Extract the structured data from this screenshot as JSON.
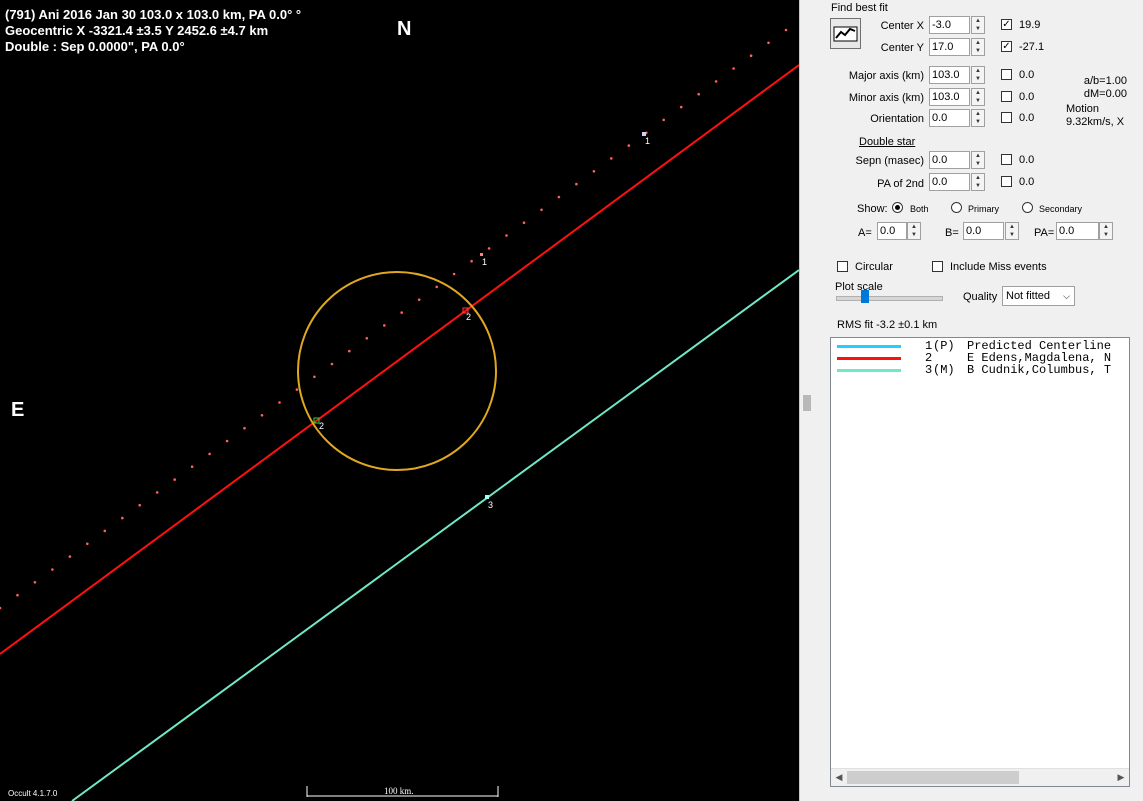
{
  "header": {
    "line1": "(791) Ani  2016 Jan 30   103.0 x 103.0 km, PA 0.0° °",
    "line2": "Geocentric  X  -3321.4 ±3.5  Y 2452.6 ±4.7 km",
    "line3": "Double : Sep  0.0000\", PA 0.0°"
  },
  "compass": {
    "north": "N",
    "east": "E"
  },
  "chord_labels": [
    "1",
    "1",
    "2",
    "2",
    "3"
  ],
  "scale_bar_label": "100 km.",
  "version": "Occult 4.1.7.0",
  "colors": {
    "ellipse": "#e0a820",
    "chord_2": "#ff1010",
    "chord_3": "#70e8c8",
    "predicted": "#20d0ff",
    "dots": "#ff6060"
  },
  "panel": {
    "find_best_fit": "Find best fit",
    "center_x": {
      "label": "Center X",
      "value": "-3.0",
      "checked": true,
      "fit": "19.9"
    },
    "center_y": {
      "label": "Center Y",
      "value": "17.0",
      "checked": true,
      "fit": "-27.1"
    },
    "major_axis": {
      "label": "Major axis (km)",
      "value": "103.0",
      "checked": false,
      "fit": "0.0"
    },
    "minor_axis": {
      "label": "Minor axis (km)",
      "value": "103.0",
      "checked": false,
      "fit": "0.0"
    },
    "orientation": {
      "label": "Orientation",
      "value": "0.0",
      "checked": false,
      "fit": "0.0"
    },
    "ab_ratio": "a/b=1.00",
    "dm": "dM=0.00",
    "motion_label": "Motion",
    "motion_value": "9.32km/s, X",
    "double_star": "Double star",
    "sepn": {
      "label": "Sepn (masec)",
      "value": "0.0",
      "checked": false,
      "fit": "0.0"
    },
    "pa2": {
      "label": "PA of 2nd",
      "value": "0.0",
      "checked": false,
      "fit": "0.0"
    },
    "show_label": "Show:",
    "show_options": [
      "Both",
      "Primary",
      "Secondary"
    ],
    "show_selected": "Both",
    "a_label": "A=",
    "a_value": "0.0",
    "b_label": "B=",
    "b_value": "0.0",
    "pa_label": "PA=",
    "pa_value": "0.0",
    "circular": "Circular",
    "include_miss": "Include Miss events",
    "plot_scale": "Plot scale",
    "quality_label": "Quality",
    "quality_value": "Not fitted",
    "rms_fit": "RMS fit -3.2 ±0.1 km"
  },
  "legend": [
    {
      "num": "1",
      "code": "(P)",
      "text": "Predicted Centerline",
      "color": "#20d0ff"
    },
    {
      "num": "2",
      "code": "   ",
      "text": "E Edens,Magdalena, N",
      "color": "#ff1010"
    },
    {
      "num": "3",
      "code": "(M)",
      "text": "B Cudnik,Columbus, T",
      "color": "#70e8c8"
    }
  ]
}
